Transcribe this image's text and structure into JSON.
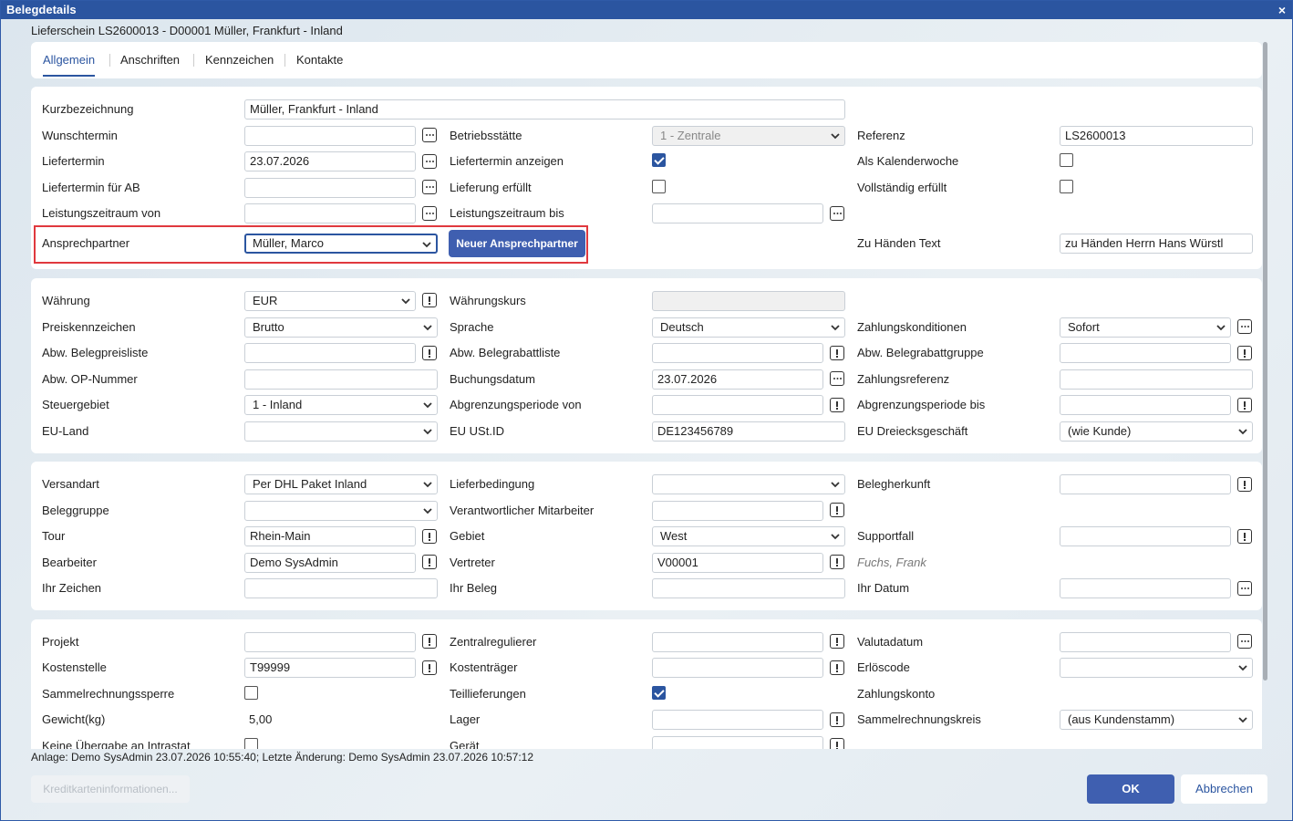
{
  "window": {
    "title": "Belegdetails",
    "close": "×"
  },
  "subtitle": "Lieferschein LS2600013 - D00001 Müller, Frankfurt - Inland",
  "tabs": [
    "Allgemein",
    "Anschriften",
    "Kennzeichen",
    "Kontakte"
  ],
  "p1": {
    "kurzbezeichnung_label": "Kurzbezeichnung",
    "kurzbezeichnung_value": "Müller, Frankfurt  - Inland",
    "wunschtermin_label": "Wunschtermin",
    "betriebsstaette_label": "Betriebsstätte",
    "betriebsstaette_value": "1 - Zentrale",
    "referenz_label": "Referenz",
    "referenz_value": "LS2600013",
    "liefertermin_label": "Liefertermin",
    "liefertermin_value": "23.07.2026",
    "liefertermin_anzeigen_label": "Liefertermin anzeigen",
    "als_kalenderwoche_label": "Als Kalenderwoche",
    "liefertermin_ab_label": "Liefertermin für AB",
    "lieferung_erfuellt_label": "Lieferung erfüllt",
    "vollstaendig_erfuellt_label": "Vollständig erfüllt",
    "leistungszeitraum_von_label": "Leistungszeitraum von",
    "leistungszeitraum_bis_label": "Leistungszeitraum bis",
    "ansprechpartner_label": "Ansprechpartner",
    "ansprechpartner_value": "Müller, Marco",
    "neuer_ansprechpartner_button": "Neuer Ansprechpartner",
    "zu_haenden_label": "Zu Händen Text",
    "zu_haenden_value": "zu Händen Herrn Hans Würstl"
  },
  "p2": {
    "waehrung_label": "Währung",
    "waehrung_value": "EUR",
    "waehrungskurs_label": "Währungskurs",
    "preiskennzeichen_label": "Preiskennzeichen",
    "preiskennzeichen_value": "Brutto",
    "sprache_label": "Sprache",
    "sprache_value": "Deutsch",
    "zahlungskonditionen_label": "Zahlungskonditionen",
    "zahlungskonditionen_value": "Sofort",
    "abw_belegpreisliste_label": "Abw. Belegpreisliste",
    "abw_belegrabattliste_label": "Abw. Belegrabattliste",
    "abw_belegrabattgruppe_label": "Abw. Belegrabattgruppe",
    "abw_op_label": "Abw. OP-Nummer",
    "buchungsdatum_label": "Buchungsdatum",
    "buchungsdatum_value": "23.07.2026",
    "zahlungsreferenz_label": "Zahlungsreferenz",
    "steuergebiet_label": "Steuergebiet",
    "steuergebiet_value": "1 - Inland",
    "abgrenzung_von_label": "Abgrenzungsperiode von",
    "abgrenzung_bis_label": "Abgrenzungsperiode bis",
    "eu_land_label": "EU-Land",
    "eu_ustid_label": "EU USt.ID",
    "eu_ustid_value": "DE123456789",
    "eu_dreieck_label": "EU Dreiecksgeschäft",
    "eu_dreieck_value": "(wie Kunde)"
  },
  "p3": {
    "versandart_label": "Versandart",
    "versandart_value": "Per DHL Paket Inland",
    "lieferbedingung_label": "Lieferbedingung",
    "belegherkunft_label": "Belegherkunft",
    "beleggruppe_label": "Beleggruppe",
    "verantwortlicher_label": "Verantwortlicher Mitarbeiter",
    "tour_label": "Tour",
    "tour_value": "Rhein-Main",
    "gebiet_label": "Gebiet",
    "gebiet_value": "West",
    "supportfall_label": "Supportfall",
    "bearbeiter_label": "Bearbeiter",
    "bearbeiter_value": "Demo SysAdmin",
    "vertreter_label": "Vertreter",
    "vertreter_value": "V00001",
    "vertreter_name": "Fuchs, Frank",
    "ihr_zeichen_label": "Ihr Zeichen",
    "ihr_beleg_label": "Ihr Beleg",
    "ihr_datum_label": "Ihr Datum"
  },
  "p4": {
    "projekt_label": "Projekt",
    "zentralregulierer_label": "Zentralregulierer",
    "valutadatum_label": "Valutadatum",
    "kostenstelle_label": "Kostenstelle",
    "kostenstelle_value": "T99999",
    "kostentraeger_label": "Kostenträger",
    "erloescode_label": "Erlöscode",
    "sammelrechnungssperre_label": "Sammelrechnungssperre",
    "teillieferungen_label": "Teillieferungen",
    "zahlungskonto_label": "Zahlungskonto",
    "gewicht_label": "Gewicht(kg)",
    "gewicht_value": "5,00",
    "lager_label": "Lager",
    "sammelrechnungskreis_label": "Sammelrechnungskreis",
    "sammelrechnungskreis_value": "(aus Kundenstamm)",
    "intrastat_label": "Keine Übergabe an Intrastat",
    "geraet_label": "Gerät"
  },
  "status": "Anlage: Demo SysAdmin 23.07.2026 10:55:40; Letzte Änderung: Demo SysAdmin 23.07.2026 10:57:12",
  "footer": {
    "kredit": "Kreditkarteninformationen...",
    "ok": "OK",
    "cancel": "Abbrechen"
  }
}
